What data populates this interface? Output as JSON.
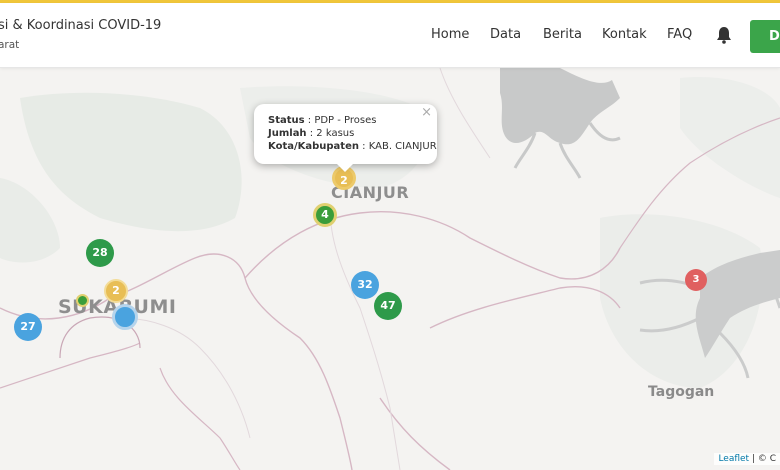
{
  "header": {
    "title": "si & Koordinasi COVID-19",
    "subtitle": "arat",
    "nav": [
      {
        "label": "Home"
      },
      {
        "label": "Data"
      },
      {
        "label": "Berita"
      },
      {
        "label": "Kontak"
      },
      {
        "label": "FAQ"
      }
    ],
    "cta_label": "D"
  },
  "map": {
    "cities": [
      {
        "name": "CIANJUR"
      },
      {
        "name": "SUKABUMI"
      },
      {
        "name": "Tagogan"
      }
    ],
    "clusters": [
      {
        "count": "2",
        "color": "#e8be55"
      },
      {
        "count": "4",
        "color": "#3a9d3a"
      },
      {
        "count": "28",
        "color": "#2e9a4a"
      },
      {
        "count": "2",
        "color": "#e8be55"
      },
      {
        "count": "",
        "color": "#3a9d3a"
      },
      {
        "count": "",
        "color": "#4aa3df"
      },
      {
        "count": "27",
        "color": "#4aa3df"
      },
      {
        "count": "32",
        "color": "#4aa3df"
      },
      {
        "count": "47",
        "color": "#2e9a4a"
      },
      {
        "count": "3",
        "color": "#e06060"
      }
    ],
    "popup": {
      "status_label": "Status",
      "status_value": "PDP - Proses",
      "jumlah_label": "Jumlah",
      "jumlah_value": "2 kasus",
      "kota_label": "Kota/Kabupaten",
      "kota_value": "KAB. CIANJUR",
      "close": "×"
    },
    "attribution": {
      "leaflet": "Leaflet",
      "rest": " | © C"
    }
  },
  "icons": {
    "bell": "bell-icon"
  }
}
